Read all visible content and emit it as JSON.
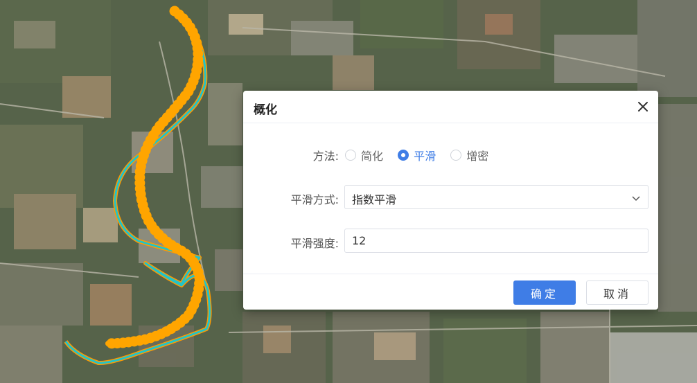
{
  "dialog": {
    "title": "概化",
    "method": {
      "label": "方法:",
      "options": [
        "简化",
        "平滑",
        "增密"
      ],
      "selected": "平滑"
    },
    "smooth_mode": {
      "label": "平滑方式:",
      "value": "指数平滑"
    },
    "smooth_strength": {
      "label": "平滑强度:",
      "value": "12"
    },
    "confirm_label": "确定",
    "cancel_label": "取消"
  },
  "colors": {
    "accent": "#3f7de6",
    "original_line": "#22c3c8",
    "smoothed_line": "#ffa500"
  },
  "icons": {
    "close": "close-icon",
    "dropdown": "chevron-down-icon"
  }
}
